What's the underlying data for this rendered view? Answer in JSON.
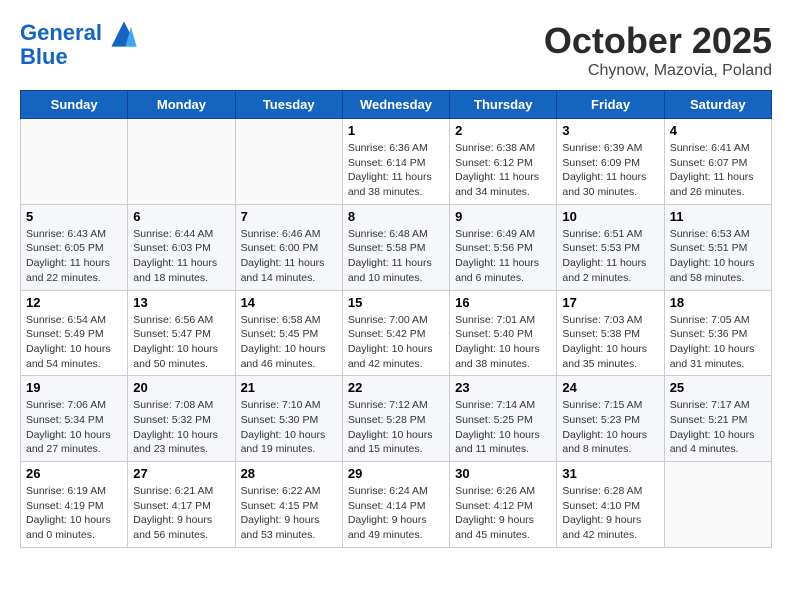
{
  "header": {
    "logo_line1": "General",
    "logo_line2": "Blue",
    "month": "October 2025",
    "location": "Chynow, Mazovia, Poland"
  },
  "days_of_week": [
    "Sunday",
    "Monday",
    "Tuesday",
    "Wednesday",
    "Thursday",
    "Friday",
    "Saturday"
  ],
  "weeks": [
    [
      {
        "num": "",
        "info": ""
      },
      {
        "num": "",
        "info": ""
      },
      {
        "num": "",
        "info": ""
      },
      {
        "num": "1",
        "info": "Sunrise: 6:36 AM\nSunset: 6:14 PM\nDaylight: 11 hours and 38 minutes."
      },
      {
        "num": "2",
        "info": "Sunrise: 6:38 AM\nSunset: 6:12 PM\nDaylight: 11 hours and 34 minutes."
      },
      {
        "num": "3",
        "info": "Sunrise: 6:39 AM\nSunset: 6:09 PM\nDaylight: 11 hours and 30 minutes."
      },
      {
        "num": "4",
        "info": "Sunrise: 6:41 AM\nSunset: 6:07 PM\nDaylight: 11 hours and 26 minutes."
      }
    ],
    [
      {
        "num": "5",
        "info": "Sunrise: 6:43 AM\nSunset: 6:05 PM\nDaylight: 11 hours and 22 minutes."
      },
      {
        "num": "6",
        "info": "Sunrise: 6:44 AM\nSunset: 6:03 PM\nDaylight: 11 hours and 18 minutes."
      },
      {
        "num": "7",
        "info": "Sunrise: 6:46 AM\nSunset: 6:00 PM\nDaylight: 11 hours and 14 minutes."
      },
      {
        "num": "8",
        "info": "Sunrise: 6:48 AM\nSunset: 5:58 PM\nDaylight: 11 hours and 10 minutes."
      },
      {
        "num": "9",
        "info": "Sunrise: 6:49 AM\nSunset: 5:56 PM\nDaylight: 11 hours and 6 minutes."
      },
      {
        "num": "10",
        "info": "Sunrise: 6:51 AM\nSunset: 5:53 PM\nDaylight: 11 hours and 2 minutes."
      },
      {
        "num": "11",
        "info": "Sunrise: 6:53 AM\nSunset: 5:51 PM\nDaylight: 10 hours and 58 minutes."
      }
    ],
    [
      {
        "num": "12",
        "info": "Sunrise: 6:54 AM\nSunset: 5:49 PM\nDaylight: 10 hours and 54 minutes."
      },
      {
        "num": "13",
        "info": "Sunrise: 6:56 AM\nSunset: 5:47 PM\nDaylight: 10 hours and 50 minutes."
      },
      {
        "num": "14",
        "info": "Sunrise: 6:58 AM\nSunset: 5:45 PM\nDaylight: 10 hours and 46 minutes."
      },
      {
        "num": "15",
        "info": "Sunrise: 7:00 AM\nSunset: 5:42 PM\nDaylight: 10 hours and 42 minutes."
      },
      {
        "num": "16",
        "info": "Sunrise: 7:01 AM\nSunset: 5:40 PM\nDaylight: 10 hours and 38 minutes."
      },
      {
        "num": "17",
        "info": "Sunrise: 7:03 AM\nSunset: 5:38 PM\nDaylight: 10 hours and 35 minutes."
      },
      {
        "num": "18",
        "info": "Sunrise: 7:05 AM\nSunset: 5:36 PM\nDaylight: 10 hours and 31 minutes."
      }
    ],
    [
      {
        "num": "19",
        "info": "Sunrise: 7:06 AM\nSunset: 5:34 PM\nDaylight: 10 hours and 27 minutes."
      },
      {
        "num": "20",
        "info": "Sunrise: 7:08 AM\nSunset: 5:32 PM\nDaylight: 10 hours and 23 minutes."
      },
      {
        "num": "21",
        "info": "Sunrise: 7:10 AM\nSunset: 5:30 PM\nDaylight: 10 hours and 19 minutes."
      },
      {
        "num": "22",
        "info": "Sunrise: 7:12 AM\nSunset: 5:28 PM\nDaylight: 10 hours and 15 minutes."
      },
      {
        "num": "23",
        "info": "Sunrise: 7:14 AM\nSunset: 5:25 PM\nDaylight: 10 hours and 11 minutes."
      },
      {
        "num": "24",
        "info": "Sunrise: 7:15 AM\nSunset: 5:23 PM\nDaylight: 10 hours and 8 minutes."
      },
      {
        "num": "25",
        "info": "Sunrise: 7:17 AM\nSunset: 5:21 PM\nDaylight: 10 hours and 4 minutes."
      }
    ],
    [
      {
        "num": "26",
        "info": "Sunrise: 6:19 AM\nSunset: 4:19 PM\nDaylight: 10 hours and 0 minutes."
      },
      {
        "num": "27",
        "info": "Sunrise: 6:21 AM\nSunset: 4:17 PM\nDaylight: 9 hours and 56 minutes."
      },
      {
        "num": "28",
        "info": "Sunrise: 6:22 AM\nSunset: 4:15 PM\nDaylight: 9 hours and 53 minutes."
      },
      {
        "num": "29",
        "info": "Sunrise: 6:24 AM\nSunset: 4:14 PM\nDaylight: 9 hours and 49 minutes."
      },
      {
        "num": "30",
        "info": "Sunrise: 6:26 AM\nSunset: 4:12 PM\nDaylight: 9 hours and 45 minutes."
      },
      {
        "num": "31",
        "info": "Sunrise: 6:28 AM\nSunset: 4:10 PM\nDaylight: 9 hours and 42 minutes."
      },
      {
        "num": "",
        "info": ""
      }
    ]
  ]
}
